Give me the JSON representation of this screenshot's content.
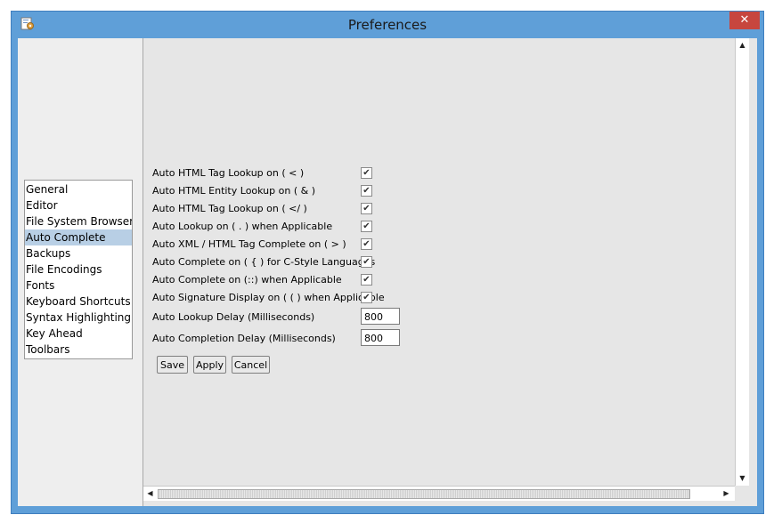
{
  "window": {
    "title": "Preferences",
    "close_glyph": "✕",
    "app_icon": "settings-app-icon"
  },
  "sidebar": {
    "items": [
      {
        "label": "General"
      },
      {
        "label": "Editor"
      },
      {
        "label": "File System Browser"
      },
      {
        "label": "Auto Complete",
        "selected": true
      },
      {
        "label": "Backups"
      },
      {
        "label": "File Encodings"
      },
      {
        "label": "Fonts"
      },
      {
        "label": "Keyboard Shortcuts"
      },
      {
        "label": "Syntax Highlighting"
      },
      {
        "label": "Key Ahead"
      },
      {
        "label": "Toolbars"
      }
    ]
  },
  "options": [
    {
      "label": "Auto HTML Tag Lookup on ( < )",
      "checked": true
    },
    {
      "label": "Auto HTML Entity Lookup on ( & )",
      "checked": true
    },
    {
      "label": "Auto HTML Tag Lookup on ( </ )",
      "checked": true
    },
    {
      "label": "Auto Lookup on ( . ) when Applicable",
      "checked": true
    },
    {
      "label": "Auto XML / HTML Tag Complete on ( > )",
      "checked": true
    },
    {
      "label": "Auto Complete on ( { ) for C-Style Languages",
      "checked": true
    },
    {
      "label": "Auto Complete on (::) when Applicable",
      "checked": true
    },
    {
      "label": "Auto Signature Display on ( ( ) when Applicable",
      "checked": true
    }
  ],
  "delays": {
    "lookup_label": "Auto Lookup Delay (Milliseconds)",
    "lookup_value": "800",
    "completion_label": "Auto Completion Delay (Milliseconds)",
    "completion_value": "800"
  },
  "buttons": {
    "save": "Save",
    "apply": "Apply",
    "cancel": "Cancel"
  },
  "glyphs": {
    "check": "✔",
    "up": "▲",
    "down": "▼",
    "left": "◀",
    "right": "▶"
  },
  "colors": {
    "titlebar": "#5f9fd8",
    "close": "#c7463e",
    "selection": "#b8cfe5",
    "client": "#e6e6e6"
  }
}
